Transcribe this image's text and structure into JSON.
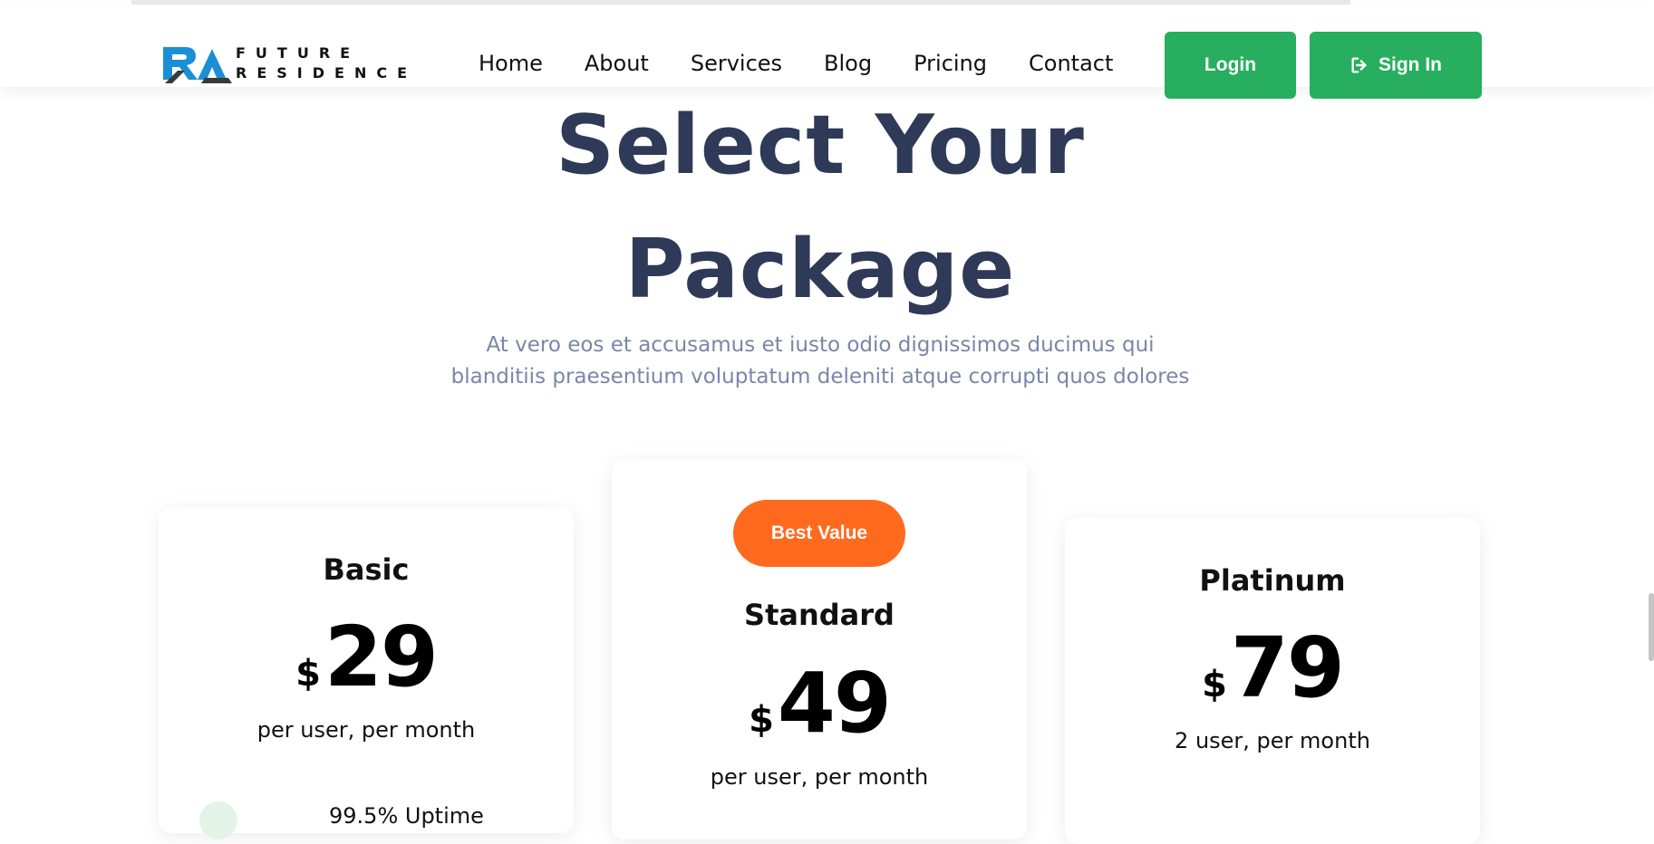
{
  "brand": {
    "name_line1": "FUTURE",
    "name_line2": "RESIDENCE",
    "colors": {
      "mark_blue": "#1a8fd6",
      "mark_dark": "#3a3a3a"
    }
  },
  "nav": {
    "items": [
      "Home",
      "About",
      "Services",
      "Blog",
      "Pricing",
      "Contact"
    ]
  },
  "header_buttons": {
    "login_label": "Login",
    "signin_label": "Sign In",
    "signin_icon": "sign-in-icon",
    "color": "#27ae5f"
  },
  "hero": {
    "title_line1": "Select Your",
    "title_line2": "Package",
    "subtitle_line1": "At vero eos et accusamus et iusto odio dignissimos ducimus qui",
    "subtitle_line2": "blanditiis praesentium voluptatum deleniti atque corrupti quos dolores"
  },
  "plans": [
    {
      "name": "Basic",
      "currency": "$",
      "price": "29",
      "period": "per user, per month",
      "feature_partial": "99.5% Uptime"
    },
    {
      "name": "Standard",
      "currency": "$",
      "price": "49",
      "period": "per user, per month",
      "badge": "Best Value",
      "badge_color": "#ff6a1f"
    },
    {
      "name": "Platinum",
      "currency": "$",
      "price": "79",
      "period": "2 user, per month"
    }
  ]
}
